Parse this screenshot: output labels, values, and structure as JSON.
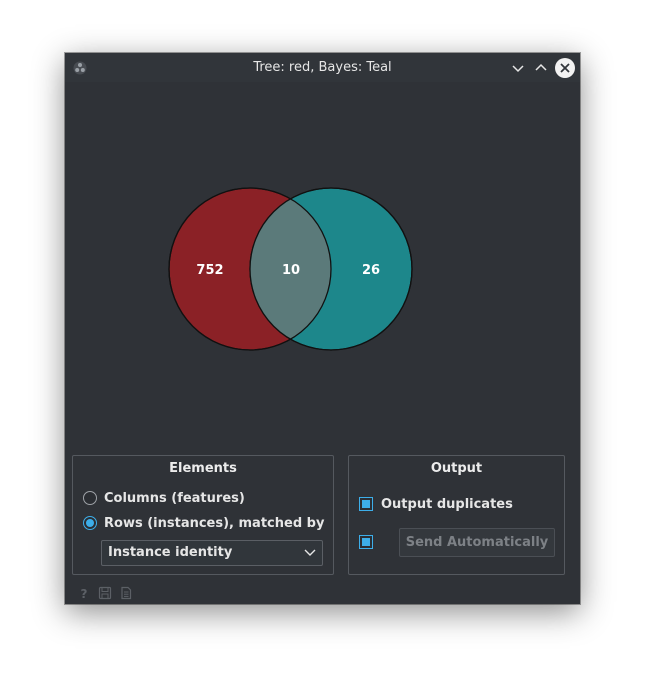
{
  "window": {
    "title": "Tree: red, Bayes: Teal"
  },
  "venn": {
    "left_only": "752",
    "intersection": "10",
    "right_only": "26",
    "colors": {
      "left": "#8b2126",
      "right": "#1d878b",
      "overlap": "#5b7a7a"
    }
  },
  "elements": {
    "title": "Elements",
    "option_columns": "Columns (features)",
    "option_rows": "Rows (instances), matched by",
    "selected": "rows",
    "match_value": "Instance identity"
  },
  "output": {
    "title": "Output",
    "duplicates_label": "Output duplicates",
    "duplicates_checked": true,
    "auto_send_checked": true,
    "send_label": "Send Automatically"
  },
  "status_icons": [
    "help-icon",
    "save-icon",
    "report-icon"
  ]
}
